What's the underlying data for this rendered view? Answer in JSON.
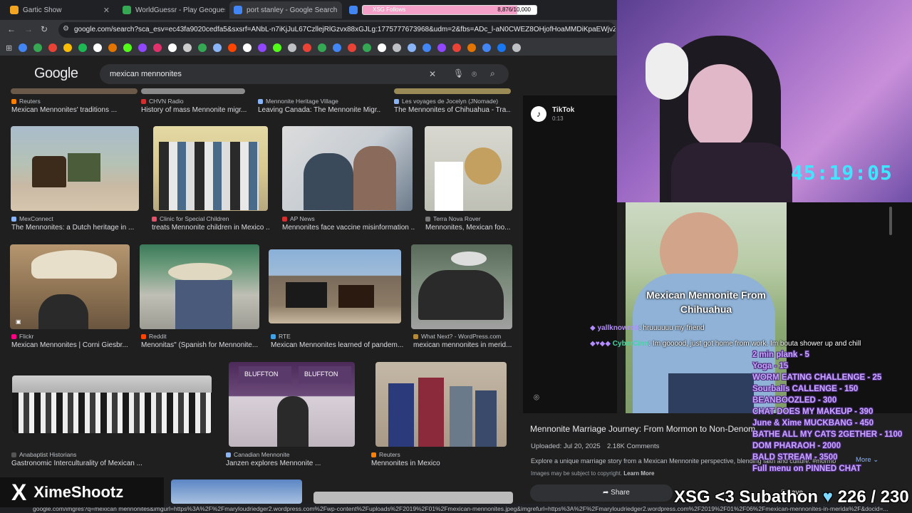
{
  "tabs": [
    {
      "label": "Gartic Show",
      "color": "#f4a623"
    },
    {
      "label": "WorldGuessr - Play Geoguessr",
      "color": "#34a853"
    },
    {
      "label": "port stanley - Google Search",
      "color": "#4285f4"
    },
    {
      "label": "XSG Follows",
      "color": "#f4a0c8"
    }
  ],
  "follows": {
    "progress": "8,876",
    "goal": "10,000",
    "fraction": 0.8876
  },
  "omnibox_url": "google.com/search?sca_esv=ec43fa9020cedfa5&sxsrf=ANbL-n7iKjJuL67CzllejRlGzvx88xGJLg:1775777673968&udm=2&fbs=ADc_l-aN0CWEZ8OHjofHoaMMDiKpaEWjvZ2Py1XXV8d8KvlI",
  "google": {
    "logo": "Google",
    "query": "mexican mennonites"
  },
  "top_row": [
    {
      "source": "Reuters",
      "caption": "Mexican Mennonites' traditions ..."
    },
    {
      "source": "CHVN Radio",
      "caption": "History of mass Mennonite migr..."
    },
    {
      "source": "Mennonite Heritage Village",
      "caption": "Leaving Canada: The Mennonite Migr..."
    },
    {
      "source": "Les voyages de Jocelyn (JNomade)",
      "caption": "The Mennonites of Chihuahua - Tra..."
    }
  ],
  "row1": [
    {
      "source": "MexConnect",
      "caption": "The Mennonites: a Dutch heritage in ..."
    },
    {
      "source": "Clinic for Special Children",
      "caption": "treats Mennonite children in Mexico ..."
    },
    {
      "source": "AP News",
      "caption": "Mennonites face vaccine misinformation ..."
    },
    {
      "source": "Terra Nova Rover",
      "caption": "Mennonites, Mexican foo..."
    }
  ],
  "row2": [
    {
      "source": "Flickr",
      "caption": "Mexican Mennonites | Corni Giesbr..."
    },
    {
      "source": "Reddit",
      "caption": "Menonitas\" (Spanish for Mennonite..."
    },
    {
      "source": "RTE",
      "caption": "Mexican Mennonites learned of pandem..."
    },
    {
      "source": "What Next? - WordPress.com",
      "caption": "mexican mennonites in merid..."
    }
  ],
  "row3": [
    {
      "source": "Anabaptist Historians",
      "caption": "Gastronomic Interculturality of Mexican ..."
    },
    {
      "source": "Canadian Mennonite",
      "caption": "Janzen explores Mennonite ..."
    },
    {
      "source": "Reuters",
      "caption": "Mennonites in Mexico"
    }
  ],
  "bluffton": "BLUFFTON",
  "panel": {
    "source": "TikTok",
    "duration": "0:13",
    "video_caption": "Mexican Mennonite From Chihuahua",
    "title": "Mennonite Marriage Journey: From Mormon to Non-Denom",
    "uploaded": "Uploaded: Jul 20, 2025",
    "comments": "2.18K Comments",
    "description": "Explore a unique marriage story from a Mexican Mennonite perspective, blending faith and culture. #mormo",
    "more": "More",
    "copyright": "Images may be subject to copyright.",
    "learn_more": "Learn More",
    "share": "Share",
    "save": "Save"
  },
  "stream": {
    "timer": "45:19:05",
    "chat": [
      {
        "user": "yallknowrob",
        "message": "hruuuuuu my friend"
      },
      {
        "user": "CyberCinn",
        "message": "Im gooood, just got home from work. Im bouta shower up and chill"
      }
    ],
    "menu": [
      "2 min plank - 5",
      "Yoga - 15",
      "WORM EATING CHALLENGE - 25",
      "Sourballs CALLENGE - 150",
      "BEANBOOZLED - 300",
      "CHAT DOES MY MAKEUP - 390",
      "June & Xime MUCKBANG - 450",
      "BATHE ALL MY CATS 2GETHER - 1100",
      "DOM PHARAOH - 2000",
      "BALD STREAM - 3500",
      "Full menu on PINNED CHAT"
    ],
    "brand_logo": "X",
    "brand_name": "XimeShootz",
    "subathon_label": "XSG <3 Subathon",
    "sub_count": "226 / 230"
  },
  "status_url": "google.com/imgres?q=mexican mennonites&imgurl=https%3A%2F%2Fmaryloudriedger2.wordpress.com%2Fwp-content%2Fuploads%2F2019%2F01%2Fmexican-mennonites.jpeg&imgrefurl=https%3A%2F%2Fmaryloudriedger2.wordpress.com%2F2019%2F01%2F06%2Fmexican-mennonites-in-merida%2F&docid=..."
}
